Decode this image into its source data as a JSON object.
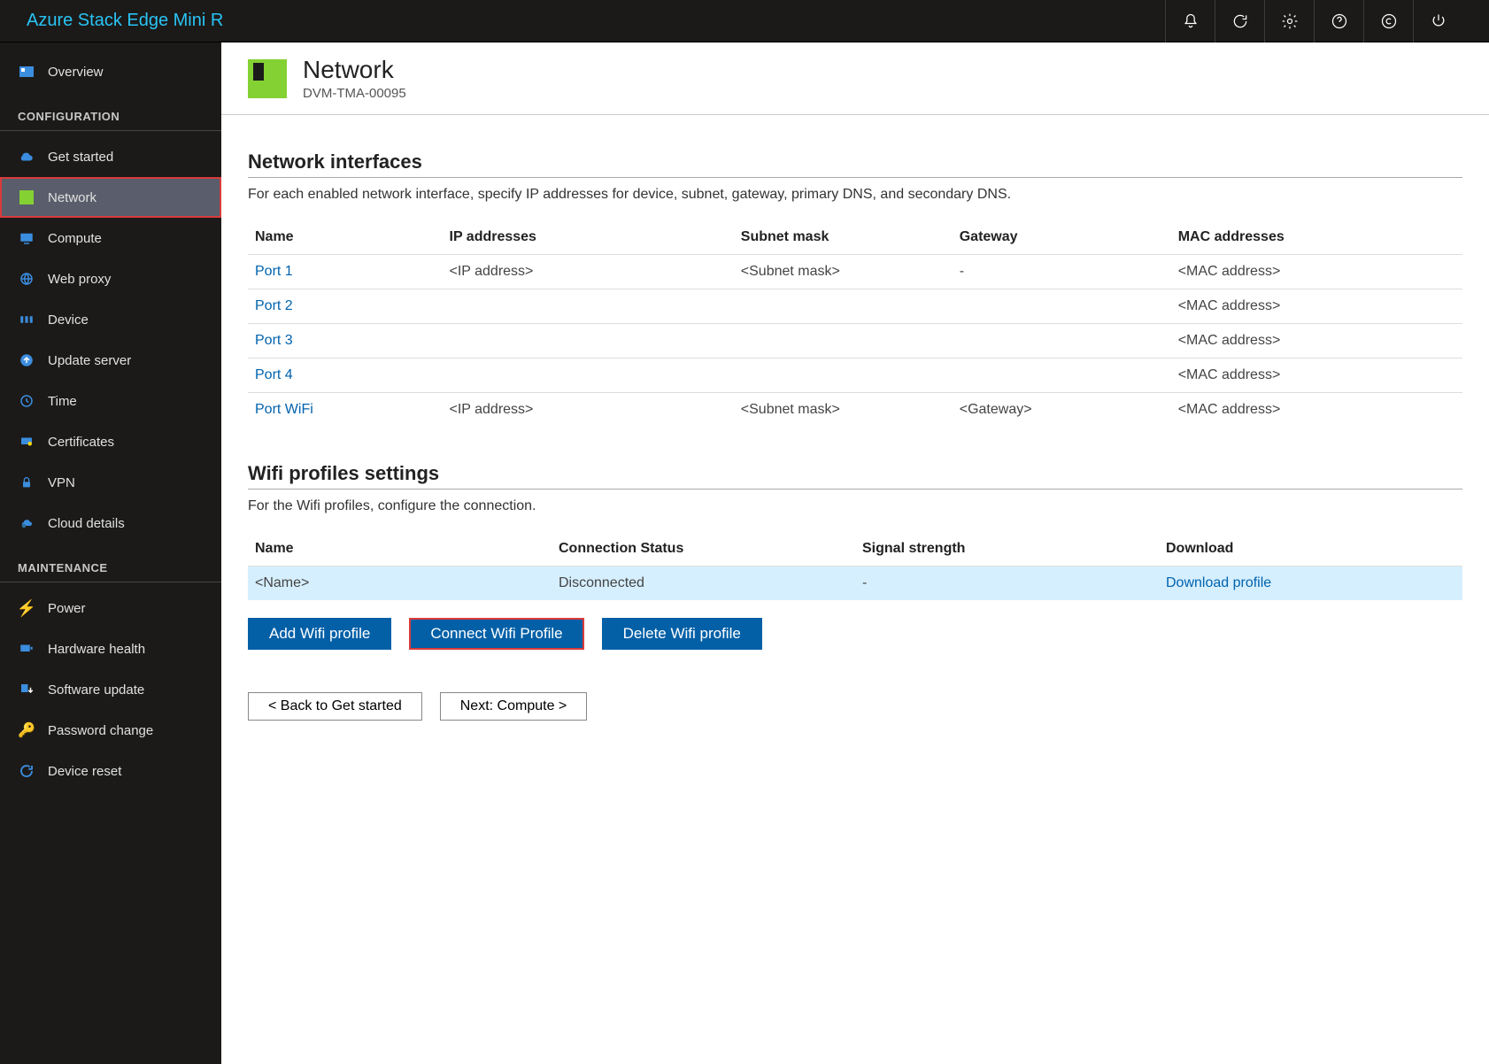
{
  "header": {
    "title": "Azure Stack Edge Mini R"
  },
  "sidebar": {
    "overview": "Overview",
    "configSection": "CONFIGURATION",
    "items": {
      "getStarted": "Get started",
      "network": "Network",
      "compute": "Compute",
      "webProxy": "Web proxy",
      "device": "Device",
      "updateServer": "Update server",
      "time": "Time",
      "certificates": "Certificates",
      "vpn": "VPN",
      "cloudDetails": "Cloud details"
    },
    "maintSection": "MAINTENANCE",
    "maint": {
      "power": "Power",
      "hardwareHealth": "Hardware health",
      "softwareUpdate": "Software update",
      "passwordChange": "Password change",
      "deviceReset": "Device reset"
    }
  },
  "page": {
    "title": "Network",
    "subtitle": "DVM-TMA-00095"
  },
  "interfaces": {
    "title": "Network interfaces",
    "desc": "For each enabled network interface, specify IP addresses for device, subnet, gateway, primary DNS, and secondary DNS.",
    "cols": {
      "name": "Name",
      "ip": "IP addresses",
      "subnet": "Subnet mask",
      "gateway": "Gateway",
      "mac": "MAC addresses"
    },
    "rows": [
      {
        "name": "Port 1",
        "ip": "<IP address>",
        "subnet": "<Subnet mask>",
        "gateway": "-",
        "mac": "<MAC address>"
      },
      {
        "name": "Port 2",
        "ip": "",
        "subnet": "",
        "gateway": "",
        "mac": "<MAC address>"
      },
      {
        "name": "Port 3",
        "ip": "",
        "subnet": "",
        "gateway": "",
        "mac": "<MAC address>"
      },
      {
        "name": "Port 4",
        "ip": "",
        "subnet": "",
        "gateway": "",
        "mac": "<MAC address>"
      },
      {
        "name": "Port WiFi",
        "ip": "<IP address>",
        "subnet": "<Subnet mask>",
        "gateway": "<Gateway>",
        "mac": "<MAC address>"
      }
    ]
  },
  "wifi": {
    "title": "Wifi profiles settings",
    "desc": "For the Wifi profiles, configure the connection.",
    "cols": {
      "name": "Name",
      "status": "Connection Status",
      "signal": "Signal strength",
      "download": "Download"
    },
    "row": {
      "name": "<Name>",
      "status": "Disconnected",
      "signal": "-",
      "download": "Download profile"
    },
    "btns": {
      "add": "Add Wifi profile",
      "connect": "Connect Wifi Profile",
      "delete": "Delete Wifi profile"
    }
  },
  "navBtns": {
    "back": "< Back to Get started",
    "next": "Next: Compute >"
  }
}
